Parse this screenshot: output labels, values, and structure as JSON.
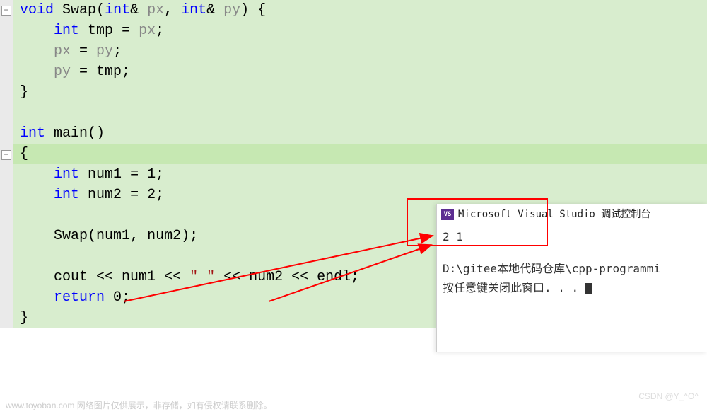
{
  "code": {
    "l1": {
      "kw": "void",
      "fn": "Swap",
      "open": "(",
      "t1": "int",
      "amp1": "& ",
      "p1": "px",
      "comma": ", ",
      "t2": "int",
      "amp2": "& ",
      "p2": "py",
      "close": ") {"
    },
    "l2": {
      "t": "int",
      "sp": " ",
      "v": "tmp",
      "eq": " = ",
      "r": "px",
      "semi": ";"
    },
    "l3": {
      "l": "px",
      "eq": " = ",
      "r": "py",
      "semi": ";"
    },
    "l4": {
      "l": "py",
      "eq": " = ",
      "r": "tmp",
      "semi": ";"
    },
    "l5": "}",
    "l6": "",
    "l7": {
      "t": "int",
      "sp": " ",
      "fn": "main",
      "paren": "()"
    },
    "l8": "{",
    "l9": {
      "t": "int",
      "sp": " ",
      "v": "num1",
      "eq": " = ",
      "n": "1",
      "semi": ";"
    },
    "l10": {
      "t": "int",
      "sp": " ",
      "v": "num2",
      "eq": " = ",
      "n": "2",
      "semi": ";"
    },
    "l11": "",
    "l12": {
      "fn": "Swap",
      "open": "(",
      "a1": "num1",
      "comma": ", ",
      "a2": "num2",
      "close": ");"
    },
    "l13": "",
    "l14": {
      "obj": "cout",
      "op1": " << ",
      "v1": "num1",
      "op2": " << ",
      "s": "\" \"",
      "op3": " << ",
      "v2": "num2",
      "op4": " << ",
      "e": "endl",
      "semi": ";"
    },
    "l15": {
      "kw": "return",
      "sp": " ",
      "n": "0",
      "semi": ";"
    },
    "l16": "}"
  },
  "fold": {
    "minus": "−"
  },
  "console": {
    "icon_text": "VS",
    "title": "Microsoft Visual Studio 调试控制台",
    "output": "2 1",
    "path": "D:\\gitee本地代码仓库\\cpp-programmi",
    "prompt": "按任意键关闭此窗口. . . "
  },
  "watermark": "www.toyoban.com 网络图片仅供展示，非存储，如有侵权请联系删除。",
  "csdn": "CSDN @Y_^O^"
}
